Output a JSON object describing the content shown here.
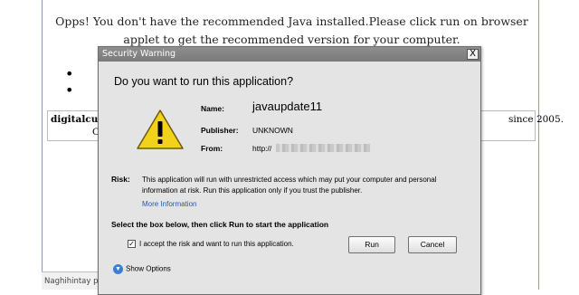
{
  "page": {
    "message": "Opps! You don't have the recommended Java installed.Please click run on browser applet to get the recommended version for your computer.",
    "bullet": "•",
    "partial_left": "digitalcurre",
    "partial_left2": "C",
    "partial_right": "since 2005.",
    "status_text": "Naghihintay pa"
  },
  "dialog": {
    "title": "Security Warning",
    "close_glyph": "X",
    "headline": "Do you want to run this application?",
    "fields": {
      "name_label": "Name:",
      "name_value": "javaupdate11",
      "publisher_label": "Publisher:",
      "publisher_value": "UNKNOWN",
      "from_label": "From:",
      "from_value": "http://"
    },
    "risk_label": "Risk:",
    "risk_text": "This application will run with unrestricted access which may put your computer and personal information at risk. Run this application only if you trust the publisher.",
    "more_info": "More Information",
    "instruction": "Select the box below, then click Run to start the application",
    "checkbox_checked": true,
    "checkbox_mark": "✓",
    "checkbox_label": "I accept the risk and want to run this application.",
    "run_label": "Run",
    "cancel_label": "Cancel",
    "show_options": "Show Options",
    "warning_icon_color": "#f2d21b",
    "link_color": "#2a5aa8"
  }
}
